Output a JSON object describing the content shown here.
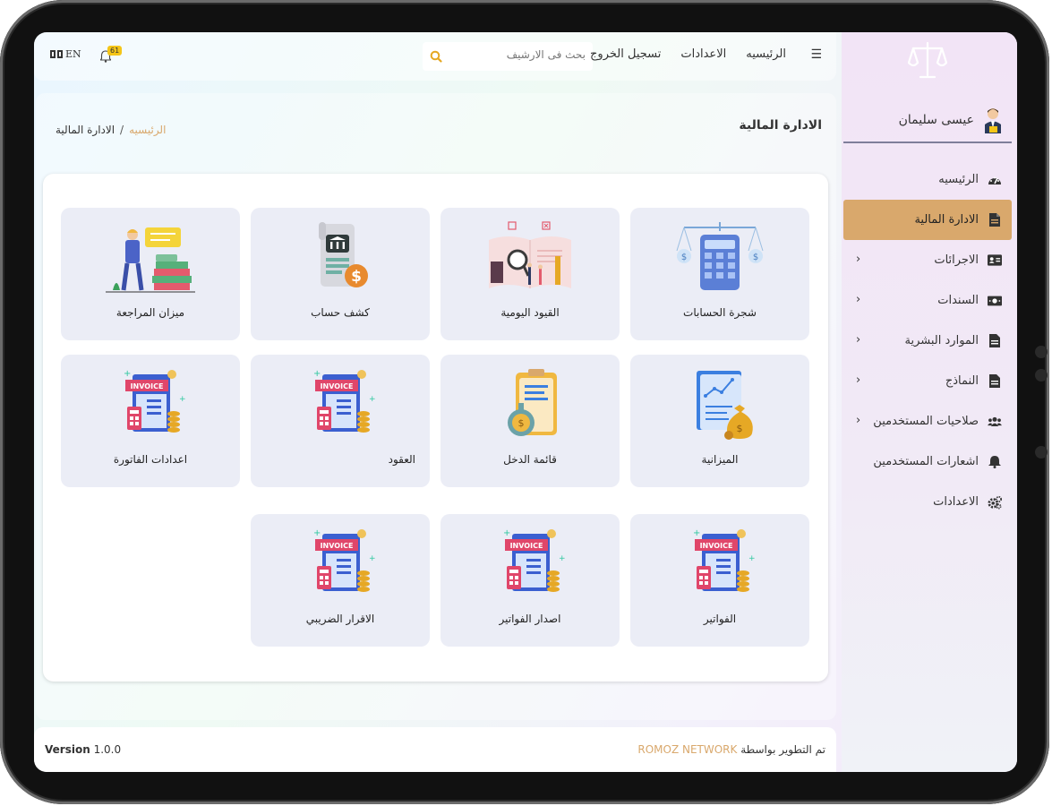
{
  "topbar": {
    "lang": "EN",
    "notifications_count": "61",
    "search_placeholder": "بحث فى الارشيف",
    "nav": [
      "الرئيسيه",
      "الاعدادات",
      "تسجيل الخروج"
    ]
  },
  "sidebar": {
    "user_name": "عيسى سليمان",
    "items": [
      {
        "label": "الرئيسيه",
        "icon": "gauge-icon",
        "chevron": false,
        "active": false
      },
      {
        "label": "الادارة المالية",
        "icon": "file-icon",
        "chevron": false,
        "active": true
      },
      {
        "label": "الاجرائات",
        "icon": "id-card-icon",
        "chevron": true,
        "active": false
      },
      {
        "label": "السندات",
        "icon": "money-icon",
        "chevron": true,
        "active": false
      },
      {
        "label": "الموارد البشرية",
        "icon": "file-icon",
        "chevron": true,
        "active": false
      },
      {
        "label": "النماذج",
        "icon": "file-icon",
        "chevron": true,
        "active": false
      },
      {
        "label": "صلاحيات المستخدمين",
        "icon": "users-icon",
        "chevron": true,
        "active": false
      },
      {
        "label": "اشعارات المستخدمين",
        "icon": "bell-icon",
        "chevron": false,
        "active": false
      },
      {
        "label": "الاعدادات",
        "icon": "gears-icon",
        "chevron": false,
        "active": false
      }
    ]
  },
  "page": {
    "title": "الادارة المالية",
    "breadcrumb": {
      "home": "الرئيسيه",
      "separator": "/",
      "current": "الادارة المالية"
    }
  },
  "tiles": [
    {
      "label": "شجرة الحسابات",
      "art": "calculator-scale"
    },
    {
      "label": "القيود اليومية",
      "art": "book-magnifier"
    },
    {
      "label": "كشف حساب",
      "art": "receipt-bank"
    },
    {
      "label": "ميزان المراجعة",
      "art": "person-books"
    },
    {
      "label": "الميزانية",
      "art": "report-moneybag"
    },
    {
      "label": "قائمة الدخل",
      "art": "clipboard-coins"
    },
    {
      "label": "العقود",
      "art": "invoice"
    },
    {
      "label": "اعدادات الفاتورة",
      "art": "invoice"
    },
    {
      "label": "الفواتير",
      "art": "invoice"
    },
    {
      "label": "اصدار الفواتير",
      "art": "invoice"
    },
    {
      "label": "الاقرار الضريبي",
      "art": "invoice"
    }
  ],
  "footer": {
    "version_label": "Version",
    "version_number": "1.0.0",
    "credit_text": "تم التطوير بواسطة",
    "credit_brand": "ROMOZ NETWORK"
  },
  "colors": {
    "accent": "#d9a86c",
    "tile_bg": "#ebedf6",
    "badge": "#f4c518"
  }
}
